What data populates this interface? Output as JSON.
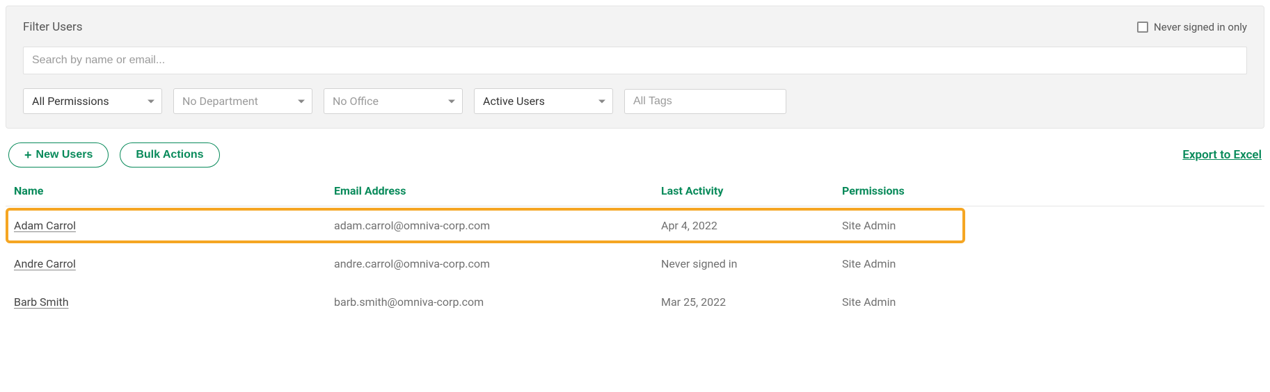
{
  "filter": {
    "title": "Filter Users",
    "never_signed_in_label": "Never signed in only",
    "search_placeholder": "Search by name or email...",
    "permissions_select": "All Permissions",
    "department_select": "No Department",
    "office_select": "No Office",
    "status_select": "Active Users",
    "tags_placeholder": "All Tags"
  },
  "actions": {
    "new_users": "New Users",
    "bulk_actions": "Bulk Actions",
    "export": "Export to Excel"
  },
  "table": {
    "headers": {
      "name": "Name",
      "email": "Email Address",
      "activity": "Last Activity",
      "permissions": "Permissions"
    },
    "rows": [
      {
        "name": "Adam Carrol",
        "email": "adam.carrol@omniva-corp.com",
        "activity": "Apr 4, 2022",
        "permissions": "Site Admin",
        "highlight": true
      },
      {
        "name": "Andre Carrol",
        "email": "andre.carrol@omniva-corp.com",
        "activity": "Never signed in",
        "permissions": "Site Admin",
        "highlight": false
      },
      {
        "name": "Barb Smith",
        "email": "barb.smith@omniva-corp.com",
        "activity": "Mar 25, 2022",
        "permissions": "Site Admin",
        "highlight": false
      }
    ]
  }
}
